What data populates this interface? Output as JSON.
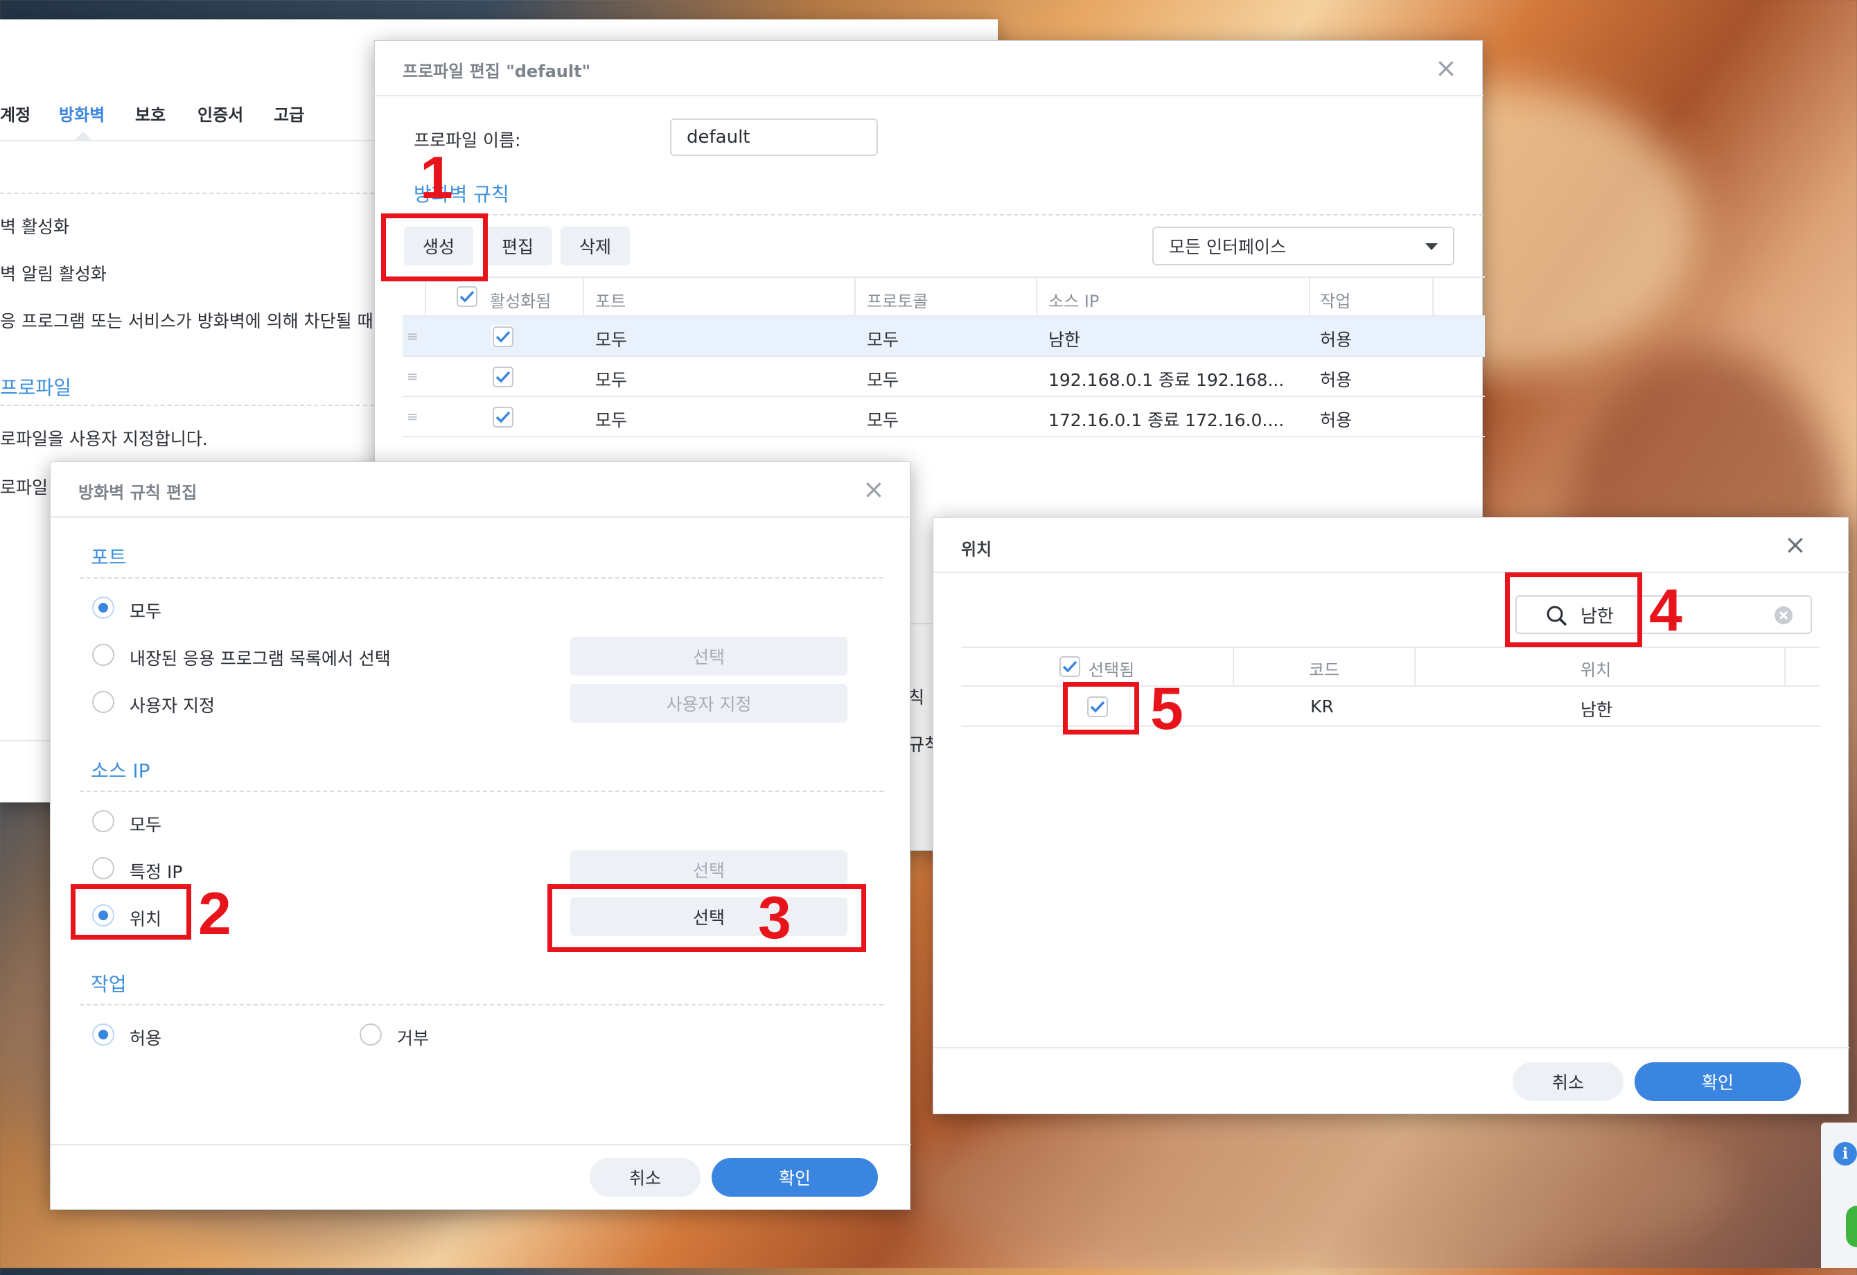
{
  "bg_window": {
    "tabs": [
      "계정",
      "방화벽",
      "보호",
      "인증서",
      "고급"
    ],
    "active_tab_index": 1,
    "lines": [
      "벽 활성화",
      "벽 알림 활성화",
      "응 프로그램 또는 서비스가 방화벽에 의해 차단될 때 알"
    ],
    "profile_section": "프로파일",
    "profile_desc": "로파일을 사용자 지정합니다.",
    "profile_label": "로파일",
    "peek_texts": [
      "칙",
      "규칙"
    ]
  },
  "profile_dialog": {
    "title": "프로파일 편집 \"default\"",
    "name_label": "프로파일 이름:",
    "name_value": "default",
    "rules_section": "방화벽 규칙",
    "create_label": "생성",
    "edit_label": "편집",
    "delete_label": "삭제",
    "interface_select": "모든 인터페이스",
    "columns": [
      "활성화됨",
      "포트",
      "프로토콜",
      "소스 IP",
      "작업"
    ],
    "rows": [
      {
        "port": "모두",
        "protocol": "모두",
        "source": "남한",
        "action": "허용",
        "enabled": true
      },
      {
        "port": "모두",
        "protocol": "모두",
        "source": "192.168.0.1 종료 192.168...",
        "action": "허용",
        "enabled": true
      },
      {
        "port": "모두",
        "protocol": "모두",
        "source": "172.16.0.1 종료 172.16.0....",
        "action": "허용",
        "enabled": true
      }
    ]
  },
  "rule_dialog": {
    "title": "방화벽 규칙 편집",
    "port_section": "포트",
    "port_options": [
      "모두",
      "내장된 응용 프로그램 목록에서 선택",
      "사용자 지정"
    ],
    "port_select_label": "선택",
    "port_custom_label": "사용자 지정",
    "source_section": "소스 IP",
    "source_options": [
      "모두",
      "특정 IP",
      "위치"
    ],
    "source_select_label": "선택",
    "location_select_label": "선택",
    "action_section": "작업",
    "action_options": [
      "허용",
      "거부"
    ],
    "cancel_label": "취소",
    "ok_label": "확인"
  },
  "location_dialog": {
    "title": "위치",
    "search_value": "남한",
    "columns": [
      "선택됨",
      "코드",
      "위치"
    ],
    "rows": [
      {
        "code": "KR",
        "location": "남한",
        "selected": true
      }
    ],
    "cancel_label": "취소",
    "ok_label": "확인"
  },
  "annotations": [
    "1",
    "2",
    "3",
    "4",
    "5"
  ],
  "colors": {
    "accent": "#3a85e0",
    "annotation_red": "#e8141c"
  }
}
